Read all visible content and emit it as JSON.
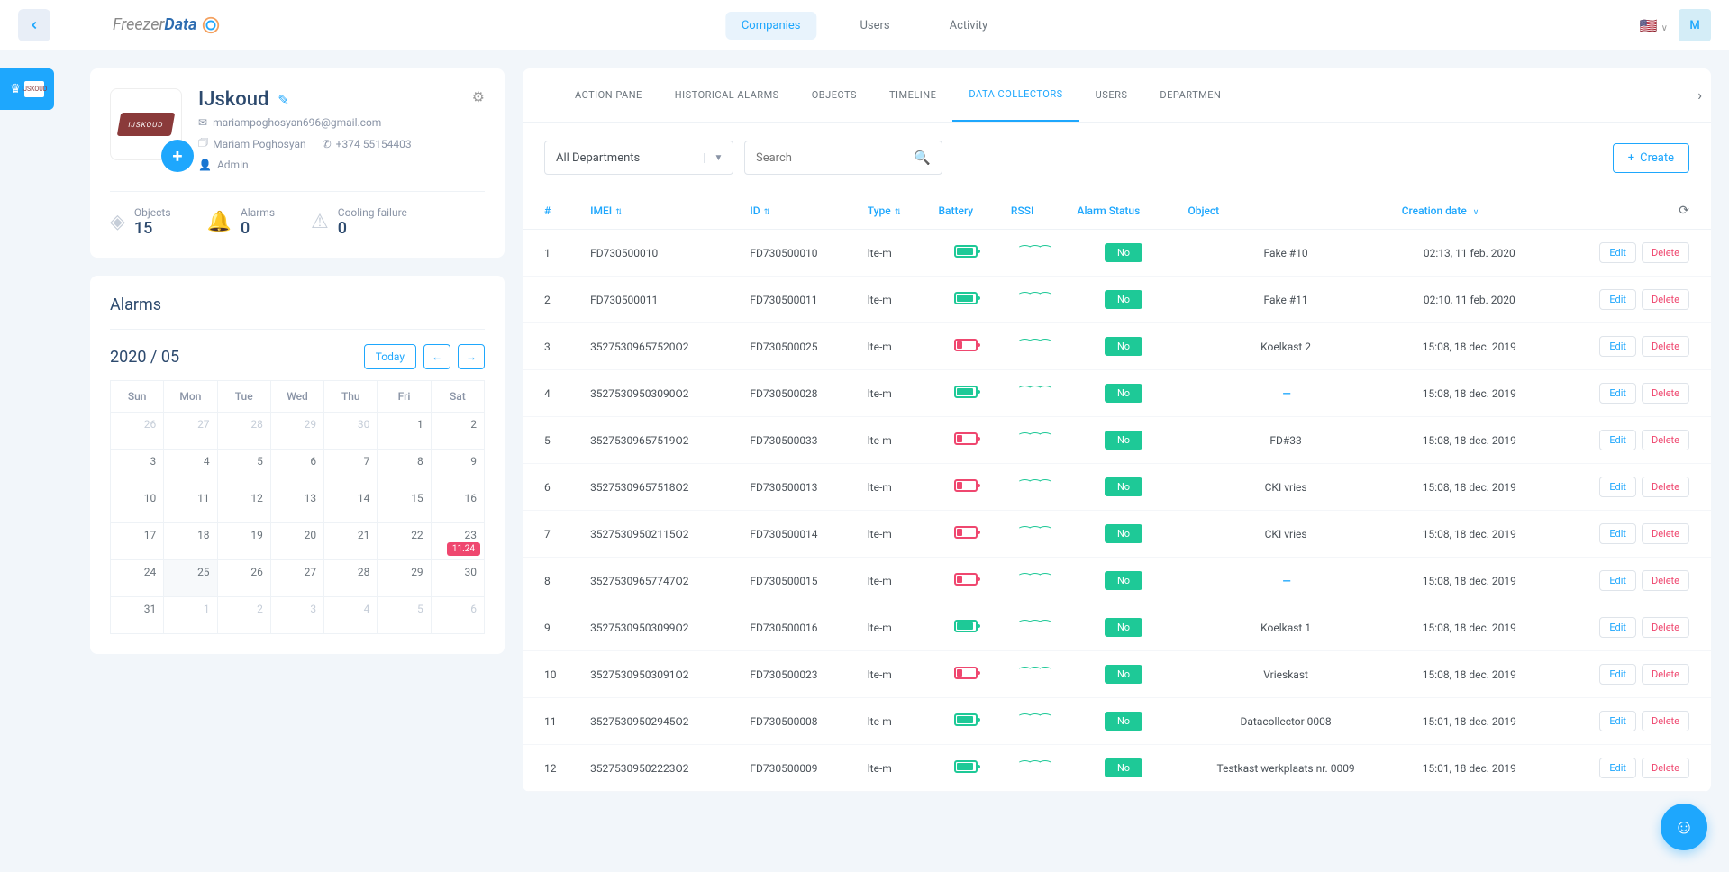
{
  "topnav": {
    "companies": "Companies",
    "users": "Users",
    "activity": "Activity"
  },
  "user_initial": "M",
  "company": {
    "name": "IJskoud",
    "logo_text": "IJSKOUD",
    "email": "mariampoghosyan696@gmail.com",
    "contact_name": "Mariam Poghosyan",
    "phone": "+374 55154403",
    "role": "Admin"
  },
  "stats": {
    "objects_label": "Objects",
    "objects_value": "15",
    "alarms_label": "Alarms",
    "alarms_value": "0",
    "cooling_label": "Cooling failure",
    "cooling_value": "0"
  },
  "alarms": {
    "title": "Alarms",
    "year_month": "2020 / 05",
    "today_label": "Today",
    "days": [
      "Sun",
      "Mon",
      "Tue",
      "Wed",
      "Thu",
      "Fri",
      "Sat"
    ],
    "weeks": [
      [
        {
          "d": "26",
          "out": true
        },
        {
          "d": "27",
          "out": true
        },
        {
          "d": "28",
          "out": true
        },
        {
          "d": "29",
          "out": true
        },
        {
          "d": "30",
          "out": true
        },
        {
          "d": "1"
        },
        {
          "d": "2"
        }
      ],
      [
        {
          "d": "3"
        },
        {
          "d": "4"
        },
        {
          "d": "5"
        },
        {
          "d": "6"
        },
        {
          "d": "7"
        },
        {
          "d": "8"
        },
        {
          "d": "9"
        }
      ],
      [
        {
          "d": "10"
        },
        {
          "d": "11"
        },
        {
          "d": "12"
        },
        {
          "d": "13"
        },
        {
          "d": "14"
        },
        {
          "d": "15"
        },
        {
          "d": "16"
        }
      ],
      [
        {
          "d": "17"
        },
        {
          "d": "18"
        },
        {
          "d": "19"
        },
        {
          "d": "20"
        },
        {
          "d": "21"
        },
        {
          "d": "22"
        },
        {
          "d": "23",
          "badge": "11.24"
        }
      ],
      [
        {
          "d": "24"
        },
        {
          "d": "25",
          "sel": true
        },
        {
          "d": "26"
        },
        {
          "d": "27"
        },
        {
          "d": "28"
        },
        {
          "d": "29"
        },
        {
          "d": "30"
        }
      ],
      [
        {
          "d": "31"
        },
        {
          "d": "1",
          "out": true
        },
        {
          "d": "2",
          "out": true
        },
        {
          "d": "3",
          "out": true
        },
        {
          "d": "4",
          "out": true
        },
        {
          "d": "5",
          "out": true
        },
        {
          "d": "6",
          "out": true
        }
      ]
    ]
  },
  "tabs": {
    "action_pane": "ACTION PANE",
    "historical": "HISTORICAL ALARMS",
    "objects": "OBJECTS",
    "timeline": "TIMELINE",
    "data_collectors": "DATA COLLECTORS",
    "users": "USERS",
    "departments": "DEPARTMEN"
  },
  "toolbar": {
    "dept_value": "All Departments",
    "search_placeholder": "Search",
    "create_label": "Create"
  },
  "table": {
    "headers": {
      "num": "#",
      "imei": "IMEI",
      "id": "ID",
      "type": "Type",
      "battery": "Battery",
      "rssi": "RSSI",
      "alarm": "Alarm Status",
      "object": "Object",
      "created": "Creation date"
    },
    "edit_label": "Edit",
    "delete_label": "Delete",
    "alarm_no": "No",
    "rows": [
      {
        "n": "1",
        "imei": "FD730500010",
        "id": "FD730500010",
        "type": "lte-m",
        "batt": "full",
        "object": "Fake #10",
        "created": "02:13, 11 feb. 2020"
      },
      {
        "n": "2",
        "imei": "FD730500011",
        "id": "FD730500011",
        "type": "lte-m",
        "batt": "full",
        "object": "Fake #11",
        "created": "02:10, 11 feb. 2020"
      },
      {
        "n": "3",
        "imei": "35275309657520O2",
        "id": "FD730500025",
        "type": "lte-m",
        "batt": "low",
        "object": "Koelkast 2",
        "created": "15:08, 18 dec. 2019"
      },
      {
        "n": "4",
        "imei": "35275309503090O2",
        "id": "FD730500028",
        "type": "lte-m",
        "batt": "full",
        "object": "—",
        "created": "15:08, 18 dec. 2019"
      },
      {
        "n": "5",
        "imei": "35275309657519O2",
        "id": "FD730500033",
        "type": "lte-m",
        "batt": "low",
        "object": "FD#33",
        "created": "15:08, 18 dec. 2019"
      },
      {
        "n": "6",
        "imei": "35275309657518O2",
        "id": "FD730500013",
        "type": "lte-m",
        "batt": "low",
        "object": "CKI vries",
        "created": "15:08, 18 dec. 2019"
      },
      {
        "n": "7",
        "imei": "35275309502115O2",
        "id": "FD730500014",
        "type": "lte-m",
        "batt": "low",
        "object": "CKI vries",
        "created": "15:08, 18 dec. 2019"
      },
      {
        "n": "8",
        "imei": "35275309657747O2",
        "id": "FD730500015",
        "type": "lte-m",
        "batt": "low",
        "object": "—",
        "created": "15:08, 18 dec. 2019"
      },
      {
        "n": "9",
        "imei": "35275309503099O2",
        "id": "FD730500016",
        "type": "lte-m",
        "batt": "full",
        "object": "Koelkast 1",
        "created": "15:08, 18 dec. 2019"
      },
      {
        "n": "10",
        "imei": "35275309503091O2",
        "id": "FD730500023",
        "type": "lte-m",
        "batt": "low",
        "object": "Vrieskast",
        "created": "15:08, 18 dec. 2019"
      },
      {
        "n": "11",
        "imei": "35275309502945O2",
        "id": "FD730500008",
        "type": "lte-m",
        "batt": "full",
        "object": "Datacollector  0008",
        "created": "15:01, 18 dec. 2019"
      },
      {
        "n": "12",
        "imei": "35275309502223O2",
        "id": "FD730500009",
        "type": "lte-m",
        "batt": "full",
        "object": "Testkast werkplaats nr. 0009",
        "created": "15:01, 18 dec. 2019"
      }
    ]
  }
}
